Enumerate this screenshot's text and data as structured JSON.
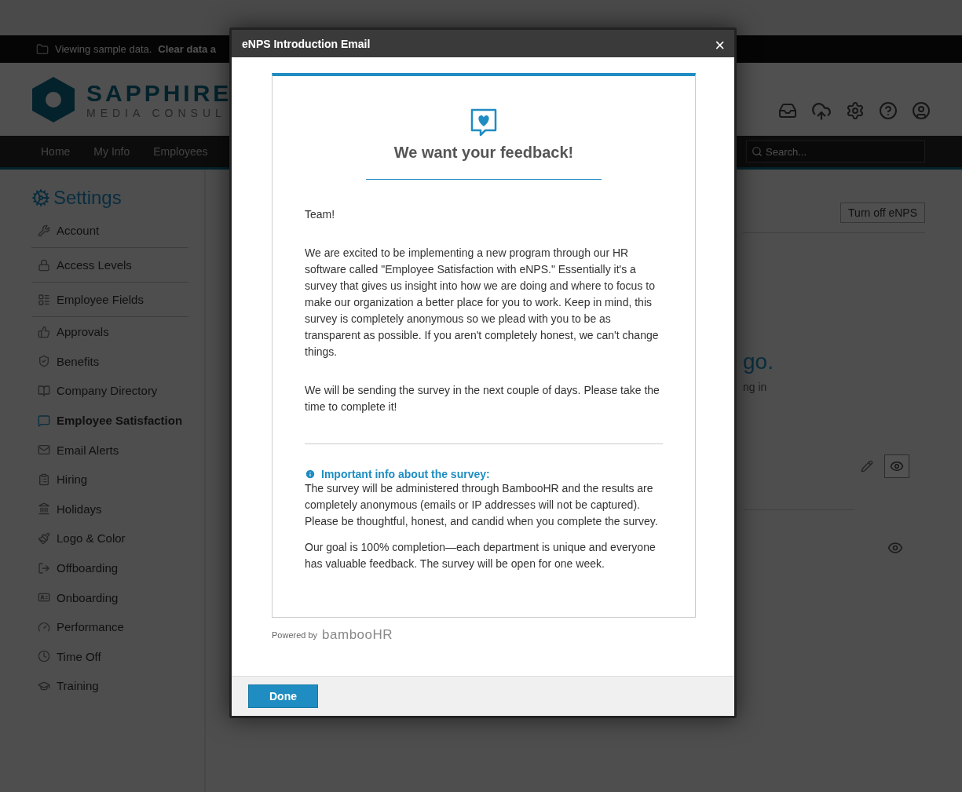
{
  "banner": {
    "text": "Viewing sample data.",
    "link": "Clear data a"
  },
  "logo": {
    "name": "SAPPHIRE",
    "tagline": "MEDIA CONSUL"
  },
  "nav": [
    "Home",
    "My Info",
    "Employees"
  ],
  "search": {
    "placeholder": "Search..."
  },
  "sidebar": {
    "title": "Settings",
    "items": [
      {
        "label": "Account",
        "selected": false
      },
      {
        "label": "Access Levels",
        "selected": false
      },
      {
        "label": "Employee Fields",
        "selected": false
      },
      {
        "label": "Approvals",
        "selected": false
      },
      {
        "label": "Benefits",
        "selected": false
      },
      {
        "label": "Company Directory",
        "selected": false
      },
      {
        "label": "Employee Satisfaction",
        "selected": true
      },
      {
        "label": "Email Alerts",
        "selected": false
      },
      {
        "label": "Hiring",
        "selected": false
      },
      {
        "label": "Holidays",
        "selected": false
      },
      {
        "label": "Logo & Color",
        "selected": false
      },
      {
        "label": "Offboarding",
        "selected": false
      },
      {
        "label": "Onboarding",
        "selected": false
      },
      {
        "label": "Performance",
        "selected": false
      },
      {
        "label": "Time Off",
        "selected": false
      },
      {
        "label": "Training",
        "selected": false
      }
    ]
  },
  "main": {
    "button": "Turn off eNPS",
    "heading_fragment": "go.",
    "subtext_fragment": "ng in"
  },
  "modal": {
    "title": "eNPS Introduction Email",
    "close": "×",
    "email": {
      "heading": "We want your feedback!",
      "greeting": "Team!",
      "paragraphs": [
        "We are excited to be implementing a new program through our HR software called \"Employee Satisfaction with eNPS.\" Essentially it's a survey that gives us insight into how we are doing and where to focus to make our organization a better place for you to work. Keep in mind, this survey is completely anonymous so we plead with you to be as transparent as possible. If you aren't completely honest, we can't change things.",
        "We will be sending the survey in the next couple of days. Please take the time to complete it!"
      ],
      "info_title": "Important info about the survey:",
      "info_paragraphs": [
        "The survey will be administered through BambooHR and the results are completely anonymous (emails or IP addresses will not be captured). Please be thoughtful, honest, and candid when you complete the survey.",
        "Our goal is 100% completion—each department is unique and everyone has valuable feedback. The survey will be open for one week."
      ]
    },
    "powered_by": "Powered by",
    "brand": "bambooHR",
    "done": "Done"
  }
}
